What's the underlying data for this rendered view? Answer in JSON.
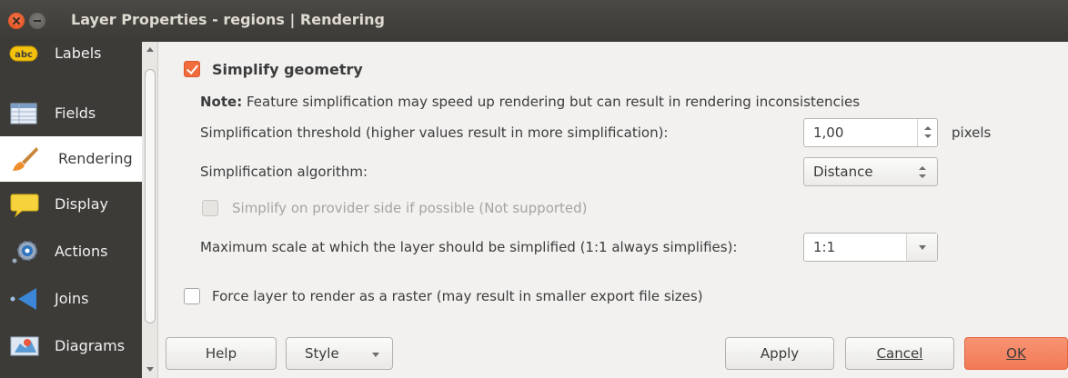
{
  "window": {
    "title": "Layer Properties - regions | Rendering"
  },
  "sidebar": {
    "items": [
      {
        "label": "Labels",
        "icon": "labels-abc-icon"
      },
      {
        "label": "Fields",
        "icon": "fields-table-icon"
      },
      {
        "label": "Rendering",
        "icon": "rendering-brush-icon"
      },
      {
        "label": "Display",
        "icon": "display-speech-bubble-icon"
      },
      {
        "label": "Actions",
        "icon": "actions-gear-icon"
      },
      {
        "label": "Joins",
        "icon": "joins-arrow-icon"
      },
      {
        "label": "Diagrams",
        "icon": "diagrams-chart-icon"
      }
    ],
    "active": "Rendering"
  },
  "rendering": {
    "simplify_label": "Simplify geometry",
    "simplify_checked": true,
    "note_bold": "Note:",
    "note_text": "Feature simplification may speed up rendering but can result in rendering inconsistencies",
    "threshold_label": "Simplification threshold (higher values result in more simplification):",
    "threshold_value": "1,00",
    "threshold_unit": "pixels",
    "algorithm_label": "Simplification algorithm:",
    "algorithm_value": "Distance",
    "provider_label": "Simplify on provider side if possible (Not supported)",
    "provider_checked": false,
    "max_scale_label": "Maximum scale at which the layer should be simplified (1:1 always simplifies):",
    "max_scale_value": "1:1",
    "raster_label": "Force layer to render as a raster (may result in smaller export file sizes)",
    "raster_checked": false
  },
  "buttons": {
    "help": "Help",
    "style": "Style",
    "apply": "Apply",
    "cancel": "Cancel",
    "ok": "OK"
  },
  "colors": {
    "accent": "#f16c3c",
    "sidebar_bg": "#3c3b37",
    "titlebar_bg": "#3b3a37"
  }
}
